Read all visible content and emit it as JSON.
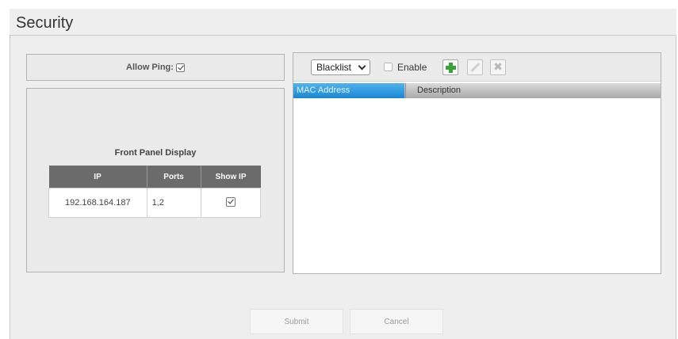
{
  "page": {
    "title": "Security"
  },
  "ping": {
    "label": "Allow Ping:",
    "checked": true
  },
  "front_panel": {
    "title": "Front Panel Display",
    "columns": [
      "IP",
      "Ports",
      "Show IP"
    ],
    "rows": [
      {
        "ip": "192.168.164.187",
        "ports": "1,2",
        "show_ip": true
      }
    ]
  },
  "mac_filter": {
    "mode": "Blacklist",
    "options": [
      "Blacklist"
    ],
    "enable_label": "Enable",
    "enabled": false,
    "columns": [
      "MAC Address",
      "Description"
    ],
    "rows": [],
    "icons": {
      "add": "plus-icon",
      "edit": "pencil-icon",
      "delete": "delete-icon"
    }
  },
  "footer": {
    "submit_label": "Submit",
    "cancel_label": "Cancel"
  },
  "colors": {
    "accent_header": "#1b86d2",
    "add_green": "#3aa335",
    "table_header": "#6b6b6b"
  }
}
